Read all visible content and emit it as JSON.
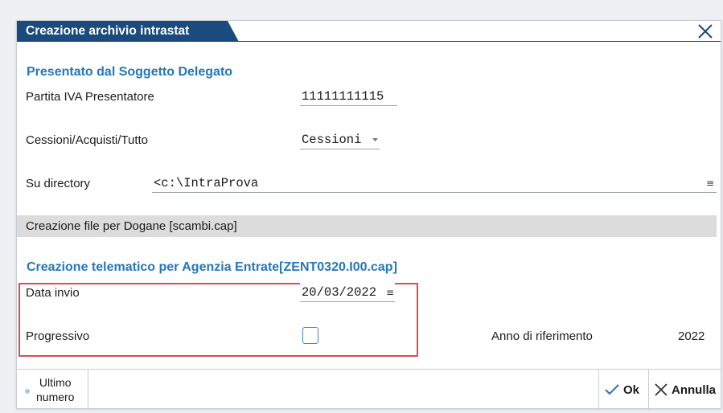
{
  "window": {
    "title": "Creazione archivio intrastat"
  },
  "section1": {
    "title": "Presentato dal Soggetto Delegato"
  },
  "partita_iva": {
    "label": "Partita IVA Presentatore",
    "value": "11111111115"
  },
  "cessioni": {
    "label": "Cessioni/Acquisti/Tutto",
    "value": "Cessioni"
  },
  "directory": {
    "label": "Su directory",
    "value": "<c:\\IntraProva"
  },
  "dogane": {
    "label": "Creazione file per Dogane [scambi.cap]"
  },
  "section2": {
    "title": "Creazione telematico per Agenzia Entrate[ZENT0320.I00.cap]"
  },
  "data_invio": {
    "label": "Data invio",
    "value": "20/03/2022"
  },
  "progressivo": {
    "label": "Progressivo",
    "checked": false
  },
  "anno": {
    "label": "Anno di riferimento",
    "value": "2022"
  },
  "buttons": {
    "ultimo_line1": "Ultimo",
    "ultimo_line2": "numero",
    "ok": "Ok",
    "annulla": "Annulla"
  },
  "icons": {
    "close": "close-icon",
    "menu": "menu-icon",
    "dropdown": "dropdown-arrow-icon",
    "check": "check-icon"
  },
  "colors": {
    "title_bg": "#1a4a7e",
    "section_title": "#2677b8",
    "highlight_box": "#e04b4b",
    "checkbox_border": "#4a85c8"
  }
}
